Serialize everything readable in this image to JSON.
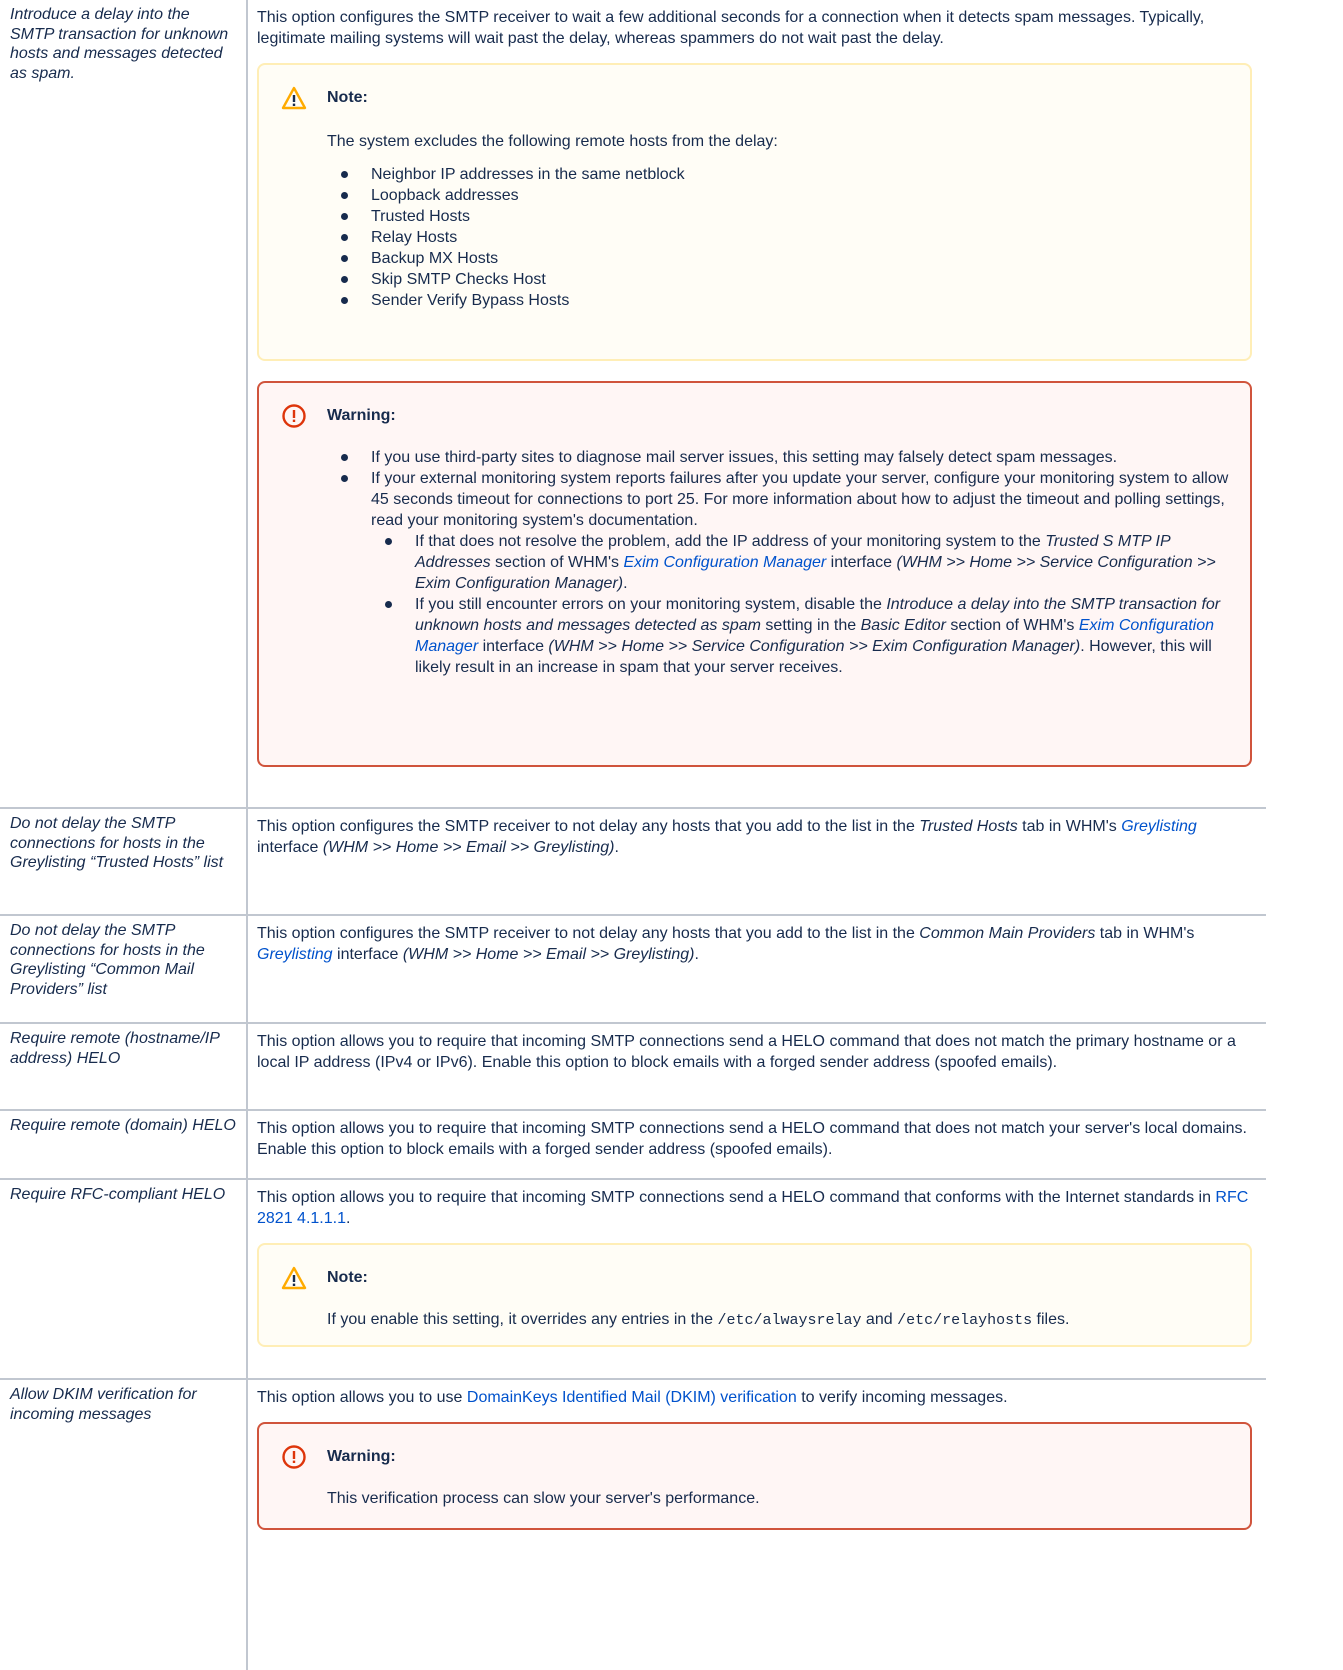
{
  "rows": [
    {
      "label": "Introduce a delay into the SMTP transaction for unknown hosts and messages detected as spam.",
      "desc": "This option configures the SMTP receiver to wait a few additional seconds for a connection when it detects spam messages. Typically, legitimate mailing systems will wait past the delay, whereas spammers do not wait past the delay.",
      "note": {
        "title": "Note:",
        "intro": "The system excludes the following remote hosts from the delay:",
        "items": [
          "Neighbor IP addresses in the same netblock",
          "Loopback addresses",
          "Trusted Hosts",
          "Relay Hosts",
          "Backup MX Hosts",
          "Skip SMTP Checks Host",
          "Sender Verify Bypass Hosts"
        ]
      },
      "warning": {
        "title": "Warning:",
        "item1": "If you use third-party sites to diagnose mail server issues, this setting may falsely detect spam messages.",
        "item2": "If your external monitoring system reports failures after you update your server, configure your monitoring system to allow 45 seconds timeout for connections to port 25. For more information about how to adjust the timeout and polling settings, read your monitoring system's documentation.",
        "sub1": {
          "pre": "If that does not resolve the problem, add the IP address of your monitoring system to the ",
          "em1": "Trusted S MTP IP Addresses",
          "mid": " section of WHM's ",
          "link": "Exim Configuration Manager",
          "mid2": " interface ",
          "path": "(WHM >> Home >> Service Configuration >> Exim Configuration Manager)",
          "end": "."
        },
        "sub2": {
          "pre": "If you still encounter errors on your monitoring system, disable the ",
          "em1": "Introduce a delay into the SMTP transaction for unknown hosts and messages detected as spam",
          "mid": " setting in the ",
          "em2": "Basic Editor",
          "mid2": " section of WHM's ",
          "link": "Exim Configuration Manager",
          "mid3": " interface ",
          "path": "(WHM >> Home >> Service Configuration >> Exim Configuration Manager)",
          "end": ". However, this will likely result in an increase in spam that your server receives."
        }
      }
    },
    {
      "label": "Do not delay the SMTP connections for hosts in the Greylisting “Trusted Hosts” list",
      "pre": "This option configures the SMTP receiver to not delay any hosts that you add to the list in the ",
      "em": "Trusted Hosts",
      "mid": " tab in WHM's ",
      "link": "Greylisting",
      "mid2": " interface ",
      "path": "(WHM >> Home >> Email >> Greylisting)",
      "end": "."
    },
    {
      "label": "Do not delay the SMTP connections for hosts in the Greylisting “Common Mail Providers” list",
      "pre": "This option configures the SMTP receiver to not delay any hosts that you add to the list in the ",
      "em": "Common Main Providers",
      "mid": " tab in WHM's ",
      "link": "Greylisting",
      "mid2": " interface ",
      "path": "(WHM >> Home >> Email >> Greylisting)",
      "end": "."
    },
    {
      "label": "Require remote (hostname/IP address) HELO",
      "desc": "This option allows you to require that incoming SMTP connections send a HELO command that does not match the primary hostname or a local IP address (IPv4 or IPv6). Enable this option to block emails with a forged sender address (spoofed emails)."
    },
    {
      "label": "Require remote (domain) HELO",
      "desc": "This option allows you to require that incoming SMTP connections send a HELO command that does not match your server's local domains. Enable this option to block emails with a forged sender address (spoofed emails)."
    },
    {
      "label": "Require RFC-compliant HELO",
      "pre": "This option allows you to require that incoming SMTP connections send a HELO command that conforms with the Internet standards in ",
      "link": "RFC 2821 4.1.1.1",
      "end": ".",
      "note": {
        "title": "Note:",
        "pre": "If you enable this setting, it overrides any entries in the ",
        "code1": "/etc/alwaysrelay",
        "mid": " and ",
        "code2": "/etc/relayhosts",
        "end": " files."
      }
    },
    {
      "label": "Allow DKIM verification for incoming messages",
      "pre": "This option allows you to use ",
      "link": "DomainKeys Identified Mail (DKIM) verification",
      "end": " to verify incoming messages.",
      "warning": {
        "title": "Warning:",
        "text": "This verification process can slow your server's performance."
      }
    }
  ],
  "icons": {
    "note": "warning-triangle-icon",
    "warning": "error-circle-icon",
    "note_color": "#ffab00",
    "warning_color": "#de350b",
    "link_color": "#0052cc"
  }
}
